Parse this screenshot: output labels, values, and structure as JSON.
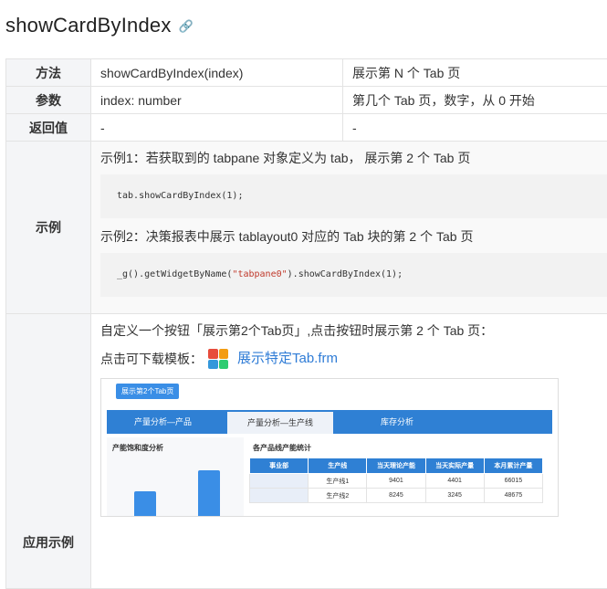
{
  "title": "showCardByIndex",
  "rows": {
    "method": {
      "label": "方法",
      "col1": "showCardByIndex(index)",
      "col2": "展示第 N 个 Tab 页"
    },
    "params": {
      "label": "参数",
      "col1": "index: number",
      "col2": "第几个 Tab 页，数字，从 0 开始"
    },
    "returns": {
      "label": "返回值",
      "col1": "-",
      "col2": "-"
    }
  },
  "example": {
    "label": "示例",
    "ex1_text": "示例1：若获取到的 tabpane 对象定义为 tab， 展示第 2 个 Tab 页",
    "ex1_code": "tab.showCardByIndex(1);",
    "ex2_text": "示例2：决策报表中展示 tablayout0 对应的 Tab 块的第 2 个 Tab 页",
    "ex2_code_pre": "_g().getWidgetByName(",
    "ex2_code_str": "\"tabpane0\"",
    "ex2_code_post": ").showCardByIndex(1);"
  },
  "usage": {
    "label": "应用示例",
    "text": "自定义一个按钮「展示第2个Tab页」,点击按钮时展示第 2 个 Tab 页：",
    "download_prefix": "点击可下载模板：",
    "download_link": "展示特定Tab.frm",
    "icon_colors": [
      "#e74c3c",
      "#f39c12",
      "#3498db",
      "#2ecc71"
    ]
  },
  "preview": {
    "button": "展示第2个Tab页",
    "tabs": [
      "产量分析—产品",
      "产量分析—生产线",
      "库存分析"
    ],
    "left_title": "产能饱和度分析",
    "left_bars": [
      0.35,
      0.6
    ],
    "right_title": "各产品线产能统计",
    "table_headers": [
      "事业部",
      "生产线",
      "当天理论产能",
      "当天实际产量",
      "本月累计产量"
    ],
    "table_rows": [
      [
        "",
        "生产线1",
        "9401",
        "4401",
        "66015"
      ],
      [
        "",
        "生产线2",
        "8245",
        "3245",
        "48675"
      ]
    ]
  }
}
